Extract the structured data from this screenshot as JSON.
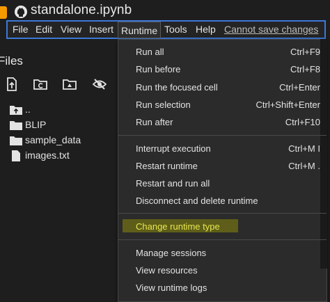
{
  "notebook": {
    "title": "standalone.ipynb"
  },
  "menubar": {
    "items": [
      "File",
      "Edit",
      "View",
      "Insert",
      "Runtime",
      "Tools",
      "Help"
    ],
    "status_link": "Cannot save changes"
  },
  "files": {
    "title": "Files",
    "toolbar_icons": [
      "upload-file-icon",
      "refresh-folder-icon",
      "drive-folder-icon",
      "hide-files-icon"
    ],
    "tree": [
      {
        "label": "..",
        "icon": "parent-folder-icon"
      },
      {
        "label": "BLIP",
        "icon": "folder-icon"
      },
      {
        "label": "sample_data",
        "icon": "folder-icon"
      },
      {
        "label": "images.txt",
        "icon": "file-icon"
      }
    ]
  },
  "runtime_menu": {
    "groups": [
      [
        {
          "label": "Run all",
          "shortcut": "Ctrl+F9"
        },
        {
          "label": "Run before",
          "shortcut": "Ctrl+F8"
        },
        {
          "label": "Run the focused cell",
          "shortcut": "Ctrl+Enter"
        },
        {
          "label": "Run selection",
          "shortcut": "Ctrl+Shift+Enter"
        },
        {
          "label": "Run after",
          "shortcut": "Ctrl+F10"
        }
      ],
      [
        {
          "label": "Interrupt execution",
          "shortcut": "Ctrl+M I"
        },
        {
          "label": "Restart runtime",
          "shortcut": "Ctrl+M ."
        },
        {
          "label": "Restart and run all",
          "shortcut": ""
        },
        {
          "label": "Disconnect and delete runtime",
          "shortcut": ""
        }
      ],
      [
        {
          "label": "Change runtime type",
          "shortcut": "",
          "highlighted": true
        }
      ],
      [
        {
          "label": "Manage sessions",
          "shortcut": ""
        },
        {
          "label": "View resources",
          "shortcut": ""
        },
        {
          "label": "View runtime logs",
          "shortcut": ""
        }
      ]
    ],
    "highlight_color": "#5e5e1a",
    "highlight_text_color": "#e6e64d"
  },
  "colors": {
    "accent": "#3c78d8",
    "logo": "#f59b00"
  }
}
